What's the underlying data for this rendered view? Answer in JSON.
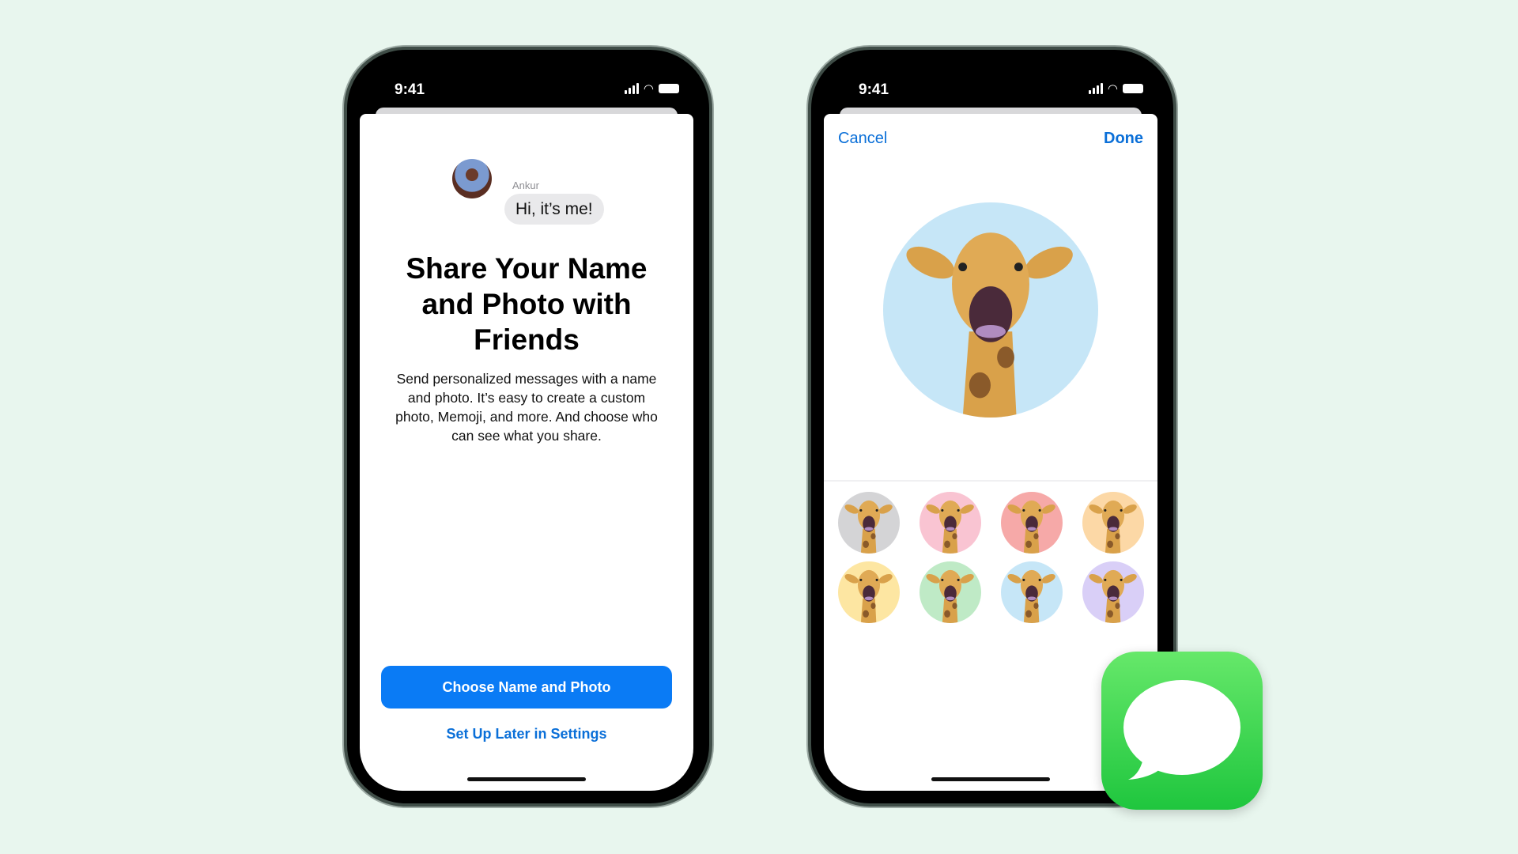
{
  "left_phone": {
    "status_time": "9:41",
    "sender_name": "Ankur",
    "message_bubble": "Hi, it’s me!",
    "title_lines": [
      "Share Your Name",
      "and Photo with",
      "Friends"
    ],
    "body_lines": [
      "Send personalized messages with a name",
      "and photo. It’s easy to create a custom",
      "photo, Memoji, and more. And choose who",
      "can see what you share."
    ],
    "primary_button": "Choose Name and Photo",
    "secondary_link": "Set Up Later in Settings"
  },
  "right_phone": {
    "status_time": "9:41",
    "cancel": "Cancel",
    "done": "Done",
    "selected_background": "#c6e6f7",
    "swatches": [
      "#d4d4d6",
      "#f9c4d2",
      "#f6a9a8",
      "#fcd8a6",
      "#fde6a2",
      "#bfeac6",
      "#c6e6f7",
      "#d9cff7"
    ]
  },
  "colors": {
    "accent": "#0a7bf5",
    "link": "#0a6fd8",
    "messages_green": "#34c759"
  },
  "app_icon": "messages-app-icon"
}
